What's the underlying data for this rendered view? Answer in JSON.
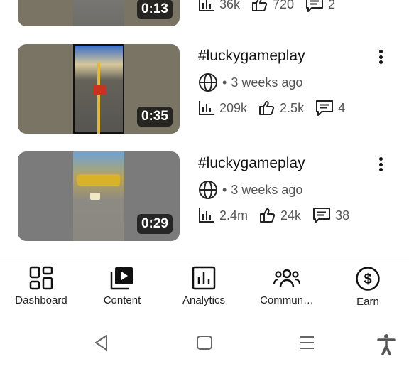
{
  "videos": [
    {
      "title": "",
      "duration": "0:13",
      "views": "36k",
      "likes": "720",
      "comments": "2"
    },
    {
      "title": "#luckygameplay",
      "visibility_icon": "globe-icon",
      "posted": "3 weeks ago",
      "duration": "0:35",
      "views": "209k",
      "likes": "2.5k",
      "comments": "4"
    },
    {
      "title": "#luckygameplay",
      "visibility_icon": "globe-icon",
      "posted": "3 weeks ago",
      "duration": "0:29",
      "views": "2.4m",
      "likes": "24k",
      "comments": "38"
    }
  ],
  "meta_separator": "•",
  "bottom_nav": [
    {
      "label": "Dashboard",
      "icon": "dashboard-icon"
    },
    {
      "label": "Content",
      "icon": "content-icon"
    },
    {
      "label": "Analytics",
      "icon": "analytics-icon"
    },
    {
      "label": "Commun…",
      "icon": "community-icon"
    },
    {
      "label": "Earn",
      "icon": "earn-icon"
    }
  ],
  "system_nav": [
    "back-icon",
    "home-icon",
    "recents-icon",
    "accessibility-icon"
  ]
}
